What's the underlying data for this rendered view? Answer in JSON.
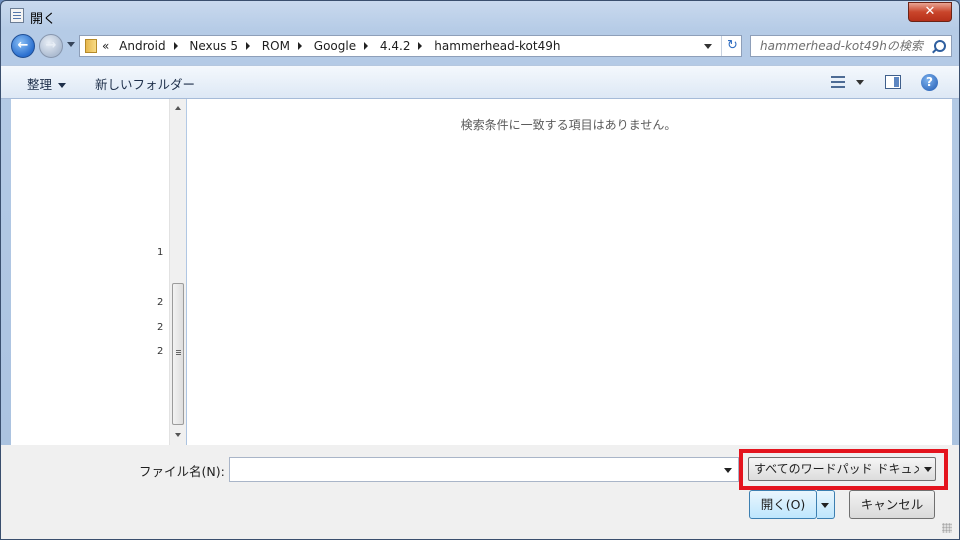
{
  "window": {
    "title": "開く",
    "close_glyph": "✕"
  },
  "navigation": {
    "back_glyph": "←",
    "forward_glyph": "→",
    "overflow_glyph": "«",
    "breadcrumbs": [
      "Android",
      "Nexus 5",
      "ROM",
      "Google",
      "4.4.2",
      "hammerhead-kot49h"
    ],
    "refresh_glyph": "↻"
  },
  "search": {
    "placeholder": "hammerhead-kot49hの検索"
  },
  "toolbar": {
    "organize_label": "整理",
    "new_folder_label": "新しいフォルダー",
    "help_glyph": "?"
  },
  "tree": {
    "visible_fragments": [
      "1",
      "2",
      "2",
      "2"
    ]
  },
  "file_list": {
    "empty_message": "検索条件に一致する項目はありません。"
  },
  "bottom": {
    "filename_label": "ファイル名(N):",
    "filename_value": "",
    "filetype_value": "すべてのワードパッド ドキュメント",
    "open_label": "開く(O)",
    "cancel_label": "キャンセル"
  },
  "colors": {
    "highlight": "#e4141e",
    "accent": "#2a6fcf"
  }
}
